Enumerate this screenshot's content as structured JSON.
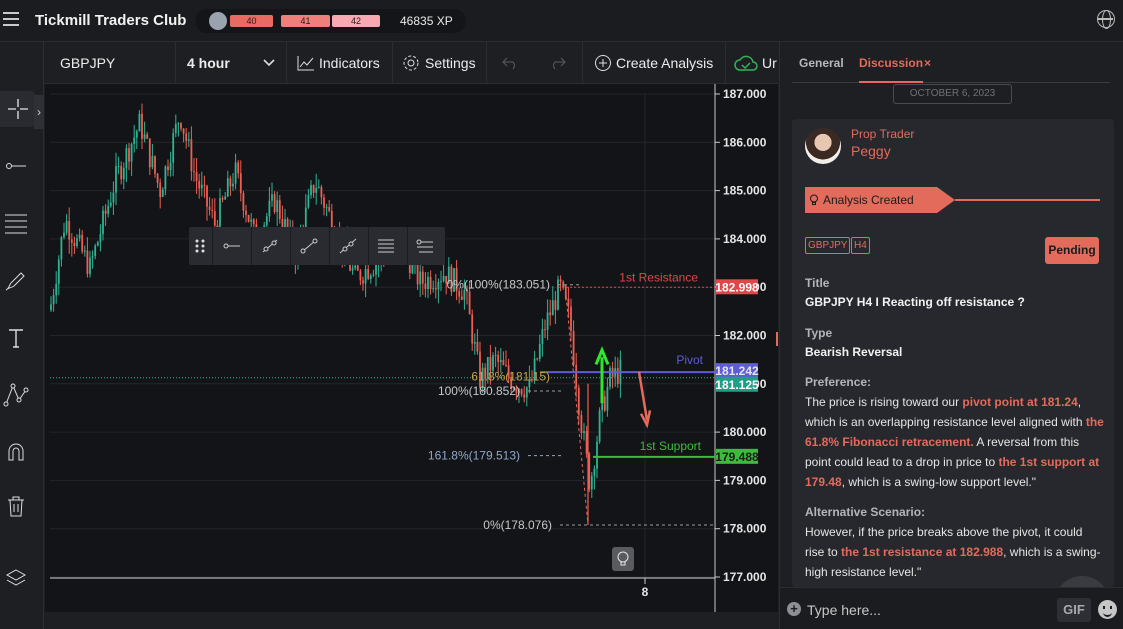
{
  "app": {
    "title": "Tickmill Traders Club",
    "levels": [
      "40",
      "41",
      "42"
    ],
    "xp": "46835 XP"
  },
  "toolbar": {
    "symbol": "GBPJPY",
    "timeframe": "4 hour",
    "indicators_label": "Indicators",
    "settings_label": "Settings",
    "create_analysis_label": "Create Analysis",
    "upload_label": "Ur"
  },
  "chart": {
    "price_ticks": [
      "187.000",
      "186.000",
      "185.000",
      "184.000",
      "183.000",
      "182.000",
      "181.000",
      "180.000",
      "179.000",
      "178.000",
      "177.000"
    ],
    "x_ticks": [
      "8"
    ],
    "levels": {
      "resistance": {
        "label": "1st Resistance",
        "price": "182.998",
        "color": "#e0464a"
      },
      "pivot": {
        "label": "Pivot",
        "price_top": "181.242",
        "price_bottom": "181.125",
        "color": "#5f5cd8"
      },
      "support": {
        "label": "1st Support",
        "price": "179.488",
        "color": "#3dbb3d"
      }
    },
    "fib_labels": {
      "top": "0%(100%(183.051)",
      "fib618": "61.8%(181.15)",
      "fib100": "100%(180.852)",
      "fib1618": "161.8%(179.513)",
      "bottom": "0%(178.076)"
    },
    "colors": {
      "up": "#2fb393",
      "down": "#ef5e53"
    }
  },
  "panel": {
    "tabs": [
      "General",
      "Discussion"
    ],
    "close_symbol": "×",
    "date": "OCTOBER 6, 2023",
    "author_role": "Prop Trader",
    "author_name": "Peggy",
    "banner": "Analysis Created",
    "tags": [
      "GBPJPY",
      "H4"
    ],
    "status": "Pending",
    "title_label": "Title",
    "title_value": "GBPJPY H4 I Reacting off resistance ?",
    "type_label": "Type",
    "type_value": "Bearish Reversal",
    "preference_label": "Preference:",
    "preference": {
      "p1": " The price is rising toward our ",
      "h1": "pivot point at 181.24",
      "p2": ", which is an overlapping resistance level aligned with ",
      "h2": "the 61.8% Fibonacci retracement.",
      "p3": " A reversal from this point could lead to a drop in price to ",
      "h3": "the 1st support at 179.48",
      "p4": ", which is a swing-low support level.\""
    },
    "alternative_label": "Alternative Scenario:",
    "alternative": {
      "p1": " However, if the price breaks above the pivot, it could rise to ",
      "h1": "the 1st resistance at 182.988",
      "p2": ", which is a swing-high resistance level.\""
    },
    "input_placeholder": "Type here...",
    "gif_label": "GIF"
  }
}
